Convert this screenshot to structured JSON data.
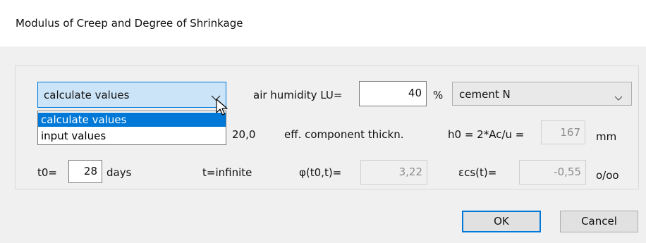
{
  "window": {
    "title": "Modulus of Creep and  Degree of Shrinkage"
  },
  "mode_combo": {
    "selected": "calculate values",
    "options": [
      "calculate values",
      "input values"
    ],
    "highlighted_index": 0
  },
  "humidity": {
    "label": "air humidity  LU=",
    "value": "40",
    "unit": "%"
  },
  "cement_combo": {
    "selected": "cement N"
  },
  "row2": {
    "partial_value": "20,0",
    "thickness_label": "eff. component thickn.",
    "h0_label": "h0 = 2*Ac/u =",
    "h0_value": "167",
    "h0_unit": "mm"
  },
  "row3": {
    "t0_label": "t0=",
    "t0_value": "28",
    "t0_unit": "days",
    "t_label": "t=infinite",
    "phi_label": "φ(t0,t)=",
    "phi_value": "3,22",
    "eps_label": "εcs(t)=",
    "eps_value": "-0,55",
    "eps_unit": "o/oo"
  },
  "buttons": {
    "ok": "OK",
    "cancel": "Cancel"
  },
  "icons": [
    "chevron-down-icon",
    "mouse-cursor-icon"
  ],
  "colors": {
    "accent": "#0078d7",
    "selection_bg": "#cce4f7",
    "dialog_bg": "#f0f0f0"
  }
}
